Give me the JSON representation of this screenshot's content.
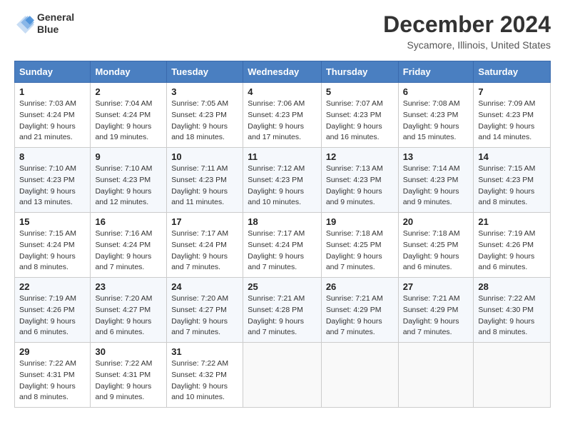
{
  "header": {
    "logo_line1": "General",
    "logo_line2": "Blue",
    "title": "December 2024",
    "subtitle": "Sycamore, Illinois, United States"
  },
  "columns": [
    "Sunday",
    "Monday",
    "Tuesday",
    "Wednesday",
    "Thursday",
    "Friday",
    "Saturday"
  ],
  "weeks": [
    [
      {
        "day": "1",
        "sunrise": "7:03 AM",
        "sunset": "4:24 PM",
        "daylight": "9 hours and 21 minutes."
      },
      {
        "day": "2",
        "sunrise": "7:04 AM",
        "sunset": "4:24 PM",
        "daylight": "9 hours and 19 minutes."
      },
      {
        "day": "3",
        "sunrise": "7:05 AM",
        "sunset": "4:23 PM",
        "daylight": "9 hours and 18 minutes."
      },
      {
        "day": "4",
        "sunrise": "7:06 AM",
        "sunset": "4:23 PM",
        "daylight": "9 hours and 17 minutes."
      },
      {
        "day": "5",
        "sunrise": "7:07 AM",
        "sunset": "4:23 PM",
        "daylight": "9 hours and 16 minutes."
      },
      {
        "day": "6",
        "sunrise": "7:08 AM",
        "sunset": "4:23 PM",
        "daylight": "9 hours and 15 minutes."
      },
      {
        "day": "7",
        "sunrise": "7:09 AM",
        "sunset": "4:23 PM",
        "daylight": "9 hours and 14 minutes."
      }
    ],
    [
      {
        "day": "8",
        "sunrise": "7:10 AM",
        "sunset": "4:23 PM",
        "daylight": "9 hours and 13 minutes."
      },
      {
        "day": "9",
        "sunrise": "7:10 AM",
        "sunset": "4:23 PM",
        "daylight": "9 hours and 12 minutes."
      },
      {
        "day": "10",
        "sunrise": "7:11 AM",
        "sunset": "4:23 PM",
        "daylight": "9 hours and 11 minutes."
      },
      {
        "day": "11",
        "sunrise": "7:12 AM",
        "sunset": "4:23 PM",
        "daylight": "9 hours and 10 minutes."
      },
      {
        "day": "12",
        "sunrise": "7:13 AM",
        "sunset": "4:23 PM",
        "daylight": "9 hours and 9 minutes."
      },
      {
        "day": "13",
        "sunrise": "7:14 AM",
        "sunset": "4:23 PM",
        "daylight": "9 hours and 9 minutes."
      },
      {
        "day": "14",
        "sunrise": "7:15 AM",
        "sunset": "4:23 PM",
        "daylight": "9 hours and 8 minutes."
      }
    ],
    [
      {
        "day": "15",
        "sunrise": "7:15 AM",
        "sunset": "4:24 PM",
        "daylight": "9 hours and 8 minutes."
      },
      {
        "day": "16",
        "sunrise": "7:16 AM",
        "sunset": "4:24 PM",
        "daylight": "9 hours and 7 minutes."
      },
      {
        "day": "17",
        "sunrise": "7:17 AM",
        "sunset": "4:24 PM",
        "daylight": "9 hours and 7 minutes."
      },
      {
        "day": "18",
        "sunrise": "7:17 AM",
        "sunset": "4:24 PM",
        "daylight": "9 hours and 7 minutes."
      },
      {
        "day": "19",
        "sunrise": "7:18 AM",
        "sunset": "4:25 PM",
        "daylight": "9 hours and 7 minutes."
      },
      {
        "day": "20",
        "sunrise": "7:18 AM",
        "sunset": "4:25 PM",
        "daylight": "9 hours and 6 minutes."
      },
      {
        "day": "21",
        "sunrise": "7:19 AM",
        "sunset": "4:26 PM",
        "daylight": "9 hours and 6 minutes."
      }
    ],
    [
      {
        "day": "22",
        "sunrise": "7:19 AM",
        "sunset": "4:26 PM",
        "daylight": "9 hours and 6 minutes."
      },
      {
        "day": "23",
        "sunrise": "7:20 AM",
        "sunset": "4:27 PM",
        "daylight": "9 hours and 6 minutes."
      },
      {
        "day": "24",
        "sunrise": "7:20 AM",
        "sunset": "4:27 PM",
        "daylight": "9 hours and 7 minutes."
      },
      {
        "day": "25",
        "sunrise": "7:21 AM",
        "sunset": "4:28 PM",
        "daylight": "9 hours and 7 minutes."
      },
      {
        "day": "26",
        "sunrise": "7:21 AM",
        "sunset": "4:29 PM",
        "daylight": "9 hours and 7 minutes."
      },
      {
        "day": "27",
        "sunrise": "7:21 AM",
        "sunset": "4:29 PM",
        "daylight": "9 hours and 7 minutes."
      },
      {
        "day": "28",
        "sunrise": "7:22 AM",
        "sunset": "4:30 PM",
        "daylight": "9 hours and 8 minutes."
      }
    ],
    [
      {
        "day": "29",
        "sunrise": "7:22 AM",
        "sunset": "4:31 PM",
        "daylight": "9 hours and 8 minutes."
      },
      {
        "day": "30",
        "sunrise": "7:22 AM",
        "sunset": "4:31 PM",
        "daylight": "9 hours and 9 minutes."
      },
      {
        "day": "31",
        "sunrise": "7:22 AM",
        "sunset": "4:32 PM",
        "daylight": "9 hours and 10 minutes."
      },
      null,
      null,
      null,
      null
    ]
  ],
  "labels": {
    "sunrise": "Sunrise:",
    "sunset": "Sunset:",
    "daylight": "Daylight:"
  }
}
